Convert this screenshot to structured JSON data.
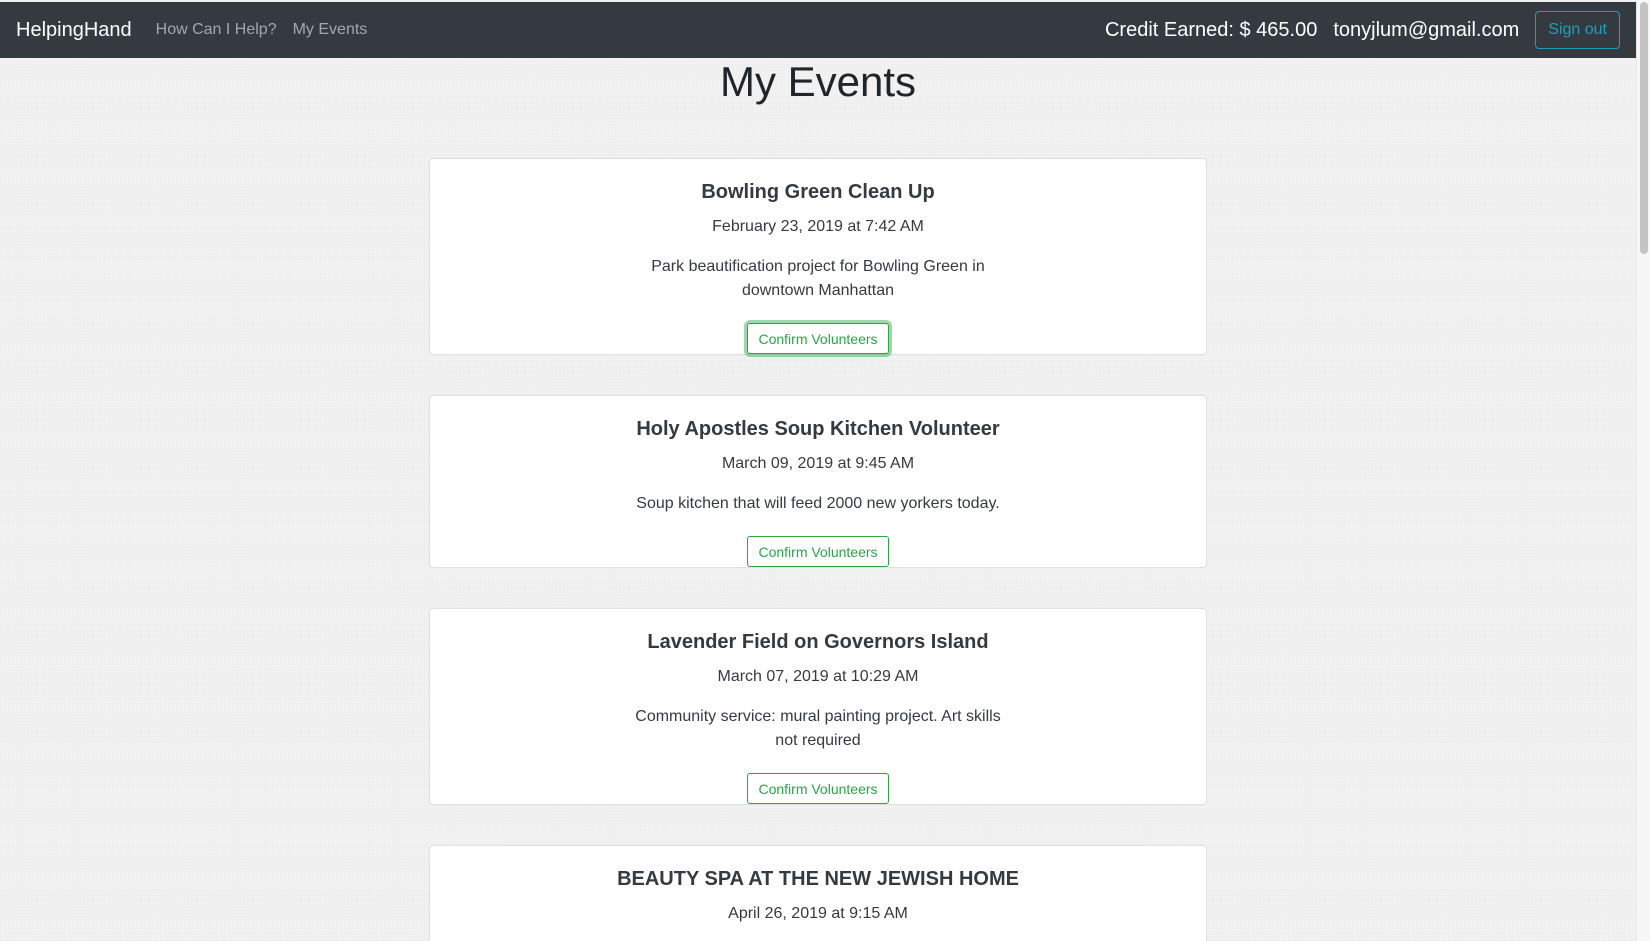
{
  "navbar": {
    "brand": "HelpingHand",
    "links": [
      "How Can I Help?",
      "My Events"
    ],
    "credit": "Credit Earned: $ 465.00",
    "email": "tonyjlum@gmail.com",
    "signout_label": "Sign out"
  },
  "page": {
    "title": "My Events"
  },
  "events": [
    {
      "title": "Bowling Green Clean Up",
      "date": "February 23, 2019 at 7:42 AM",
      "description": "Park beautification project for Bowling Green in downtown Manhattan",
      "button_label": "Confirm Volunteers"
    },
    {
      "title": "Holy Apostles Soup Kitchen Volunteer",
      "date": "March 09, 2019 at 9:45 AM",
      "description": "Soup kitchen that will feed 2000 new yorkers today.",
      "button_label": "Confirm Volunteers"
    },
    {
      "title": "Lavender Field on Governors Island",
      "date": "March 07, 2019 at 10:29 AM",
      "description": "Community service: mural painting project. Art skills not required",
      "button_label": "Confirm Volunteers"
    },
    {
      "title": "BEAUTY SPA AT THE NEW JEWISH HOME",
      "date": "April 26, 2019 at 9:15 AM"
    }
  ],
  "colors": {
    "navbar_bg": "#343a40",
    "confirm_accent": "#28a745",
    "signout_accent": "#17a2b8"
  }
}
